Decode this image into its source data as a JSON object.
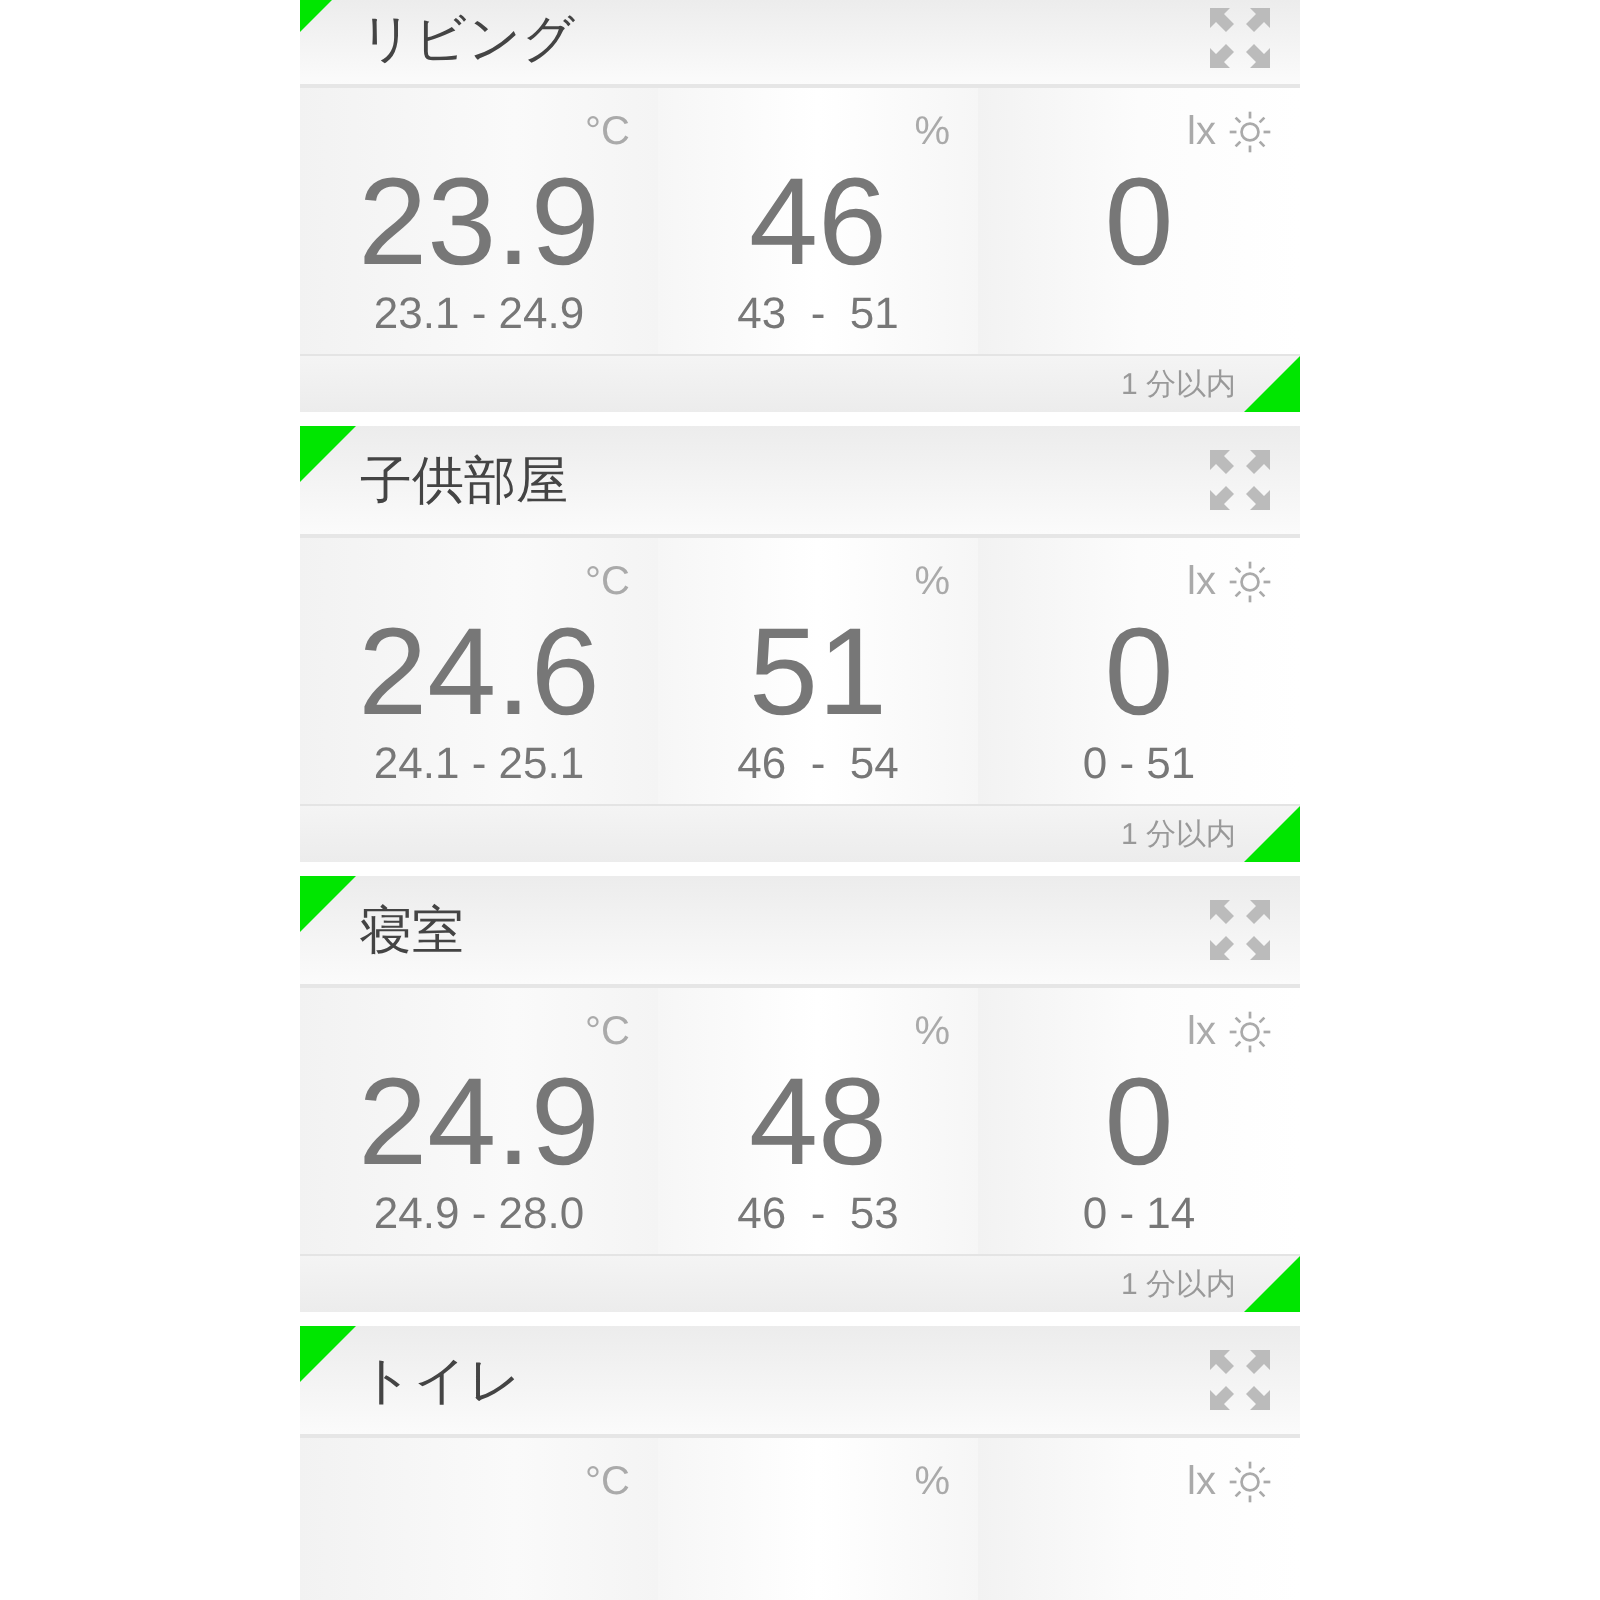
{
  "rooms": [
    {
      "name": "リビング",
      "color": "#00e600",
      "sensors": [
        {
          "kind": "temperature",
          "unit": "°C",
          "value": "23.9",
          "range": "23.1 - 24.9"
        },
        {
          "kind": "humidity",
          "unit": "%",
          "value": "46",
          "range": "43  -  51"
        },
        {
          "kind": "light",
          "unit": "lx",
          "value": "0"
        }
      ],
      "updated": "1 分以内"
    },
    {
      "name": "子供部屋",
      "color": "#00e600",
      "sensors": [
        {
          "kind": "temperature",
          "unit": "°C",
          "value": "24.6",
          "range": "24.1 - 25.1"
        },
        {
          "kind": "humidity",
          "unit": "%",
          "value": "51",
          "range": "46  -  54"
        },
        {
          "kind": "light",
          "unit": "lx",
          "value": "0",
          "range": "0 - 51"
        }
      ],
      "updated": "1 分以内"
    },
    {
      "name": "寝室",
      "color": "#00e600",
      "sensors": [
        {
          "kind": "temperature",
          "unit": "°C",
          "value": "24.9",
          "range": "24.9 - 28.0"
        },
        {
          "kind": "humidity",
          "unit": "%",
          "value": "48",
          "range": "46  -  53"
        },
        {
          "kind": "light",
          "unit": "lx",
          "value": "0",
          "range": "0 - 14"
        }
      ],
      "updated": "1 分以内"
    },
    {
      "name": "トイレ",
      "color": "#00e600",
      "sensors": [
        {
          "kind": "temperature",
          "unit": "°C"
        },
        {
          "kind": "humidity",
          "unit": "%"
        },
        {
          "kind": "light",
          "unit": "lx"
        }
      ]
    }
  ]
}
